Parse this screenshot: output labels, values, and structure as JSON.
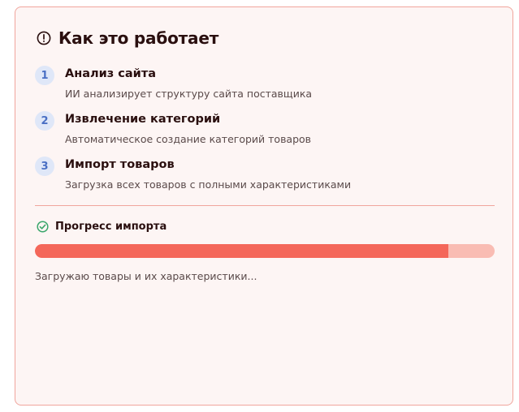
{
  "header": {
    "icon": "alert-circle-icon",
    "title": "Как это работает"
  },
  "steps": [
    {
      "number": "1",
      "title": "Анализ сайта",
      "description": "ИИ анализирует структуру сайта поставщика"
    },
    {
      "number": "2",
      "title": "Извлечение категорий",
      "description": "Автоматическое создание категорий товаров"
    },
    {
      "number": "3",
      "title": "Импорт товаров",
      "description": "Загрузка всех товаров с полными характеристиками"
    }
  ],
  "progress": {
    "icon": "check-circle-icon",
    "label": "Прогресс импорта",
    "value": 0.9,
    "status": "Загружаю товары и их характеристики...",
    "colors": {
      "fill": "#f4675a",
      "track": "#f9bcb3",
      "check": "#3aa66b"
    }
  }
}
